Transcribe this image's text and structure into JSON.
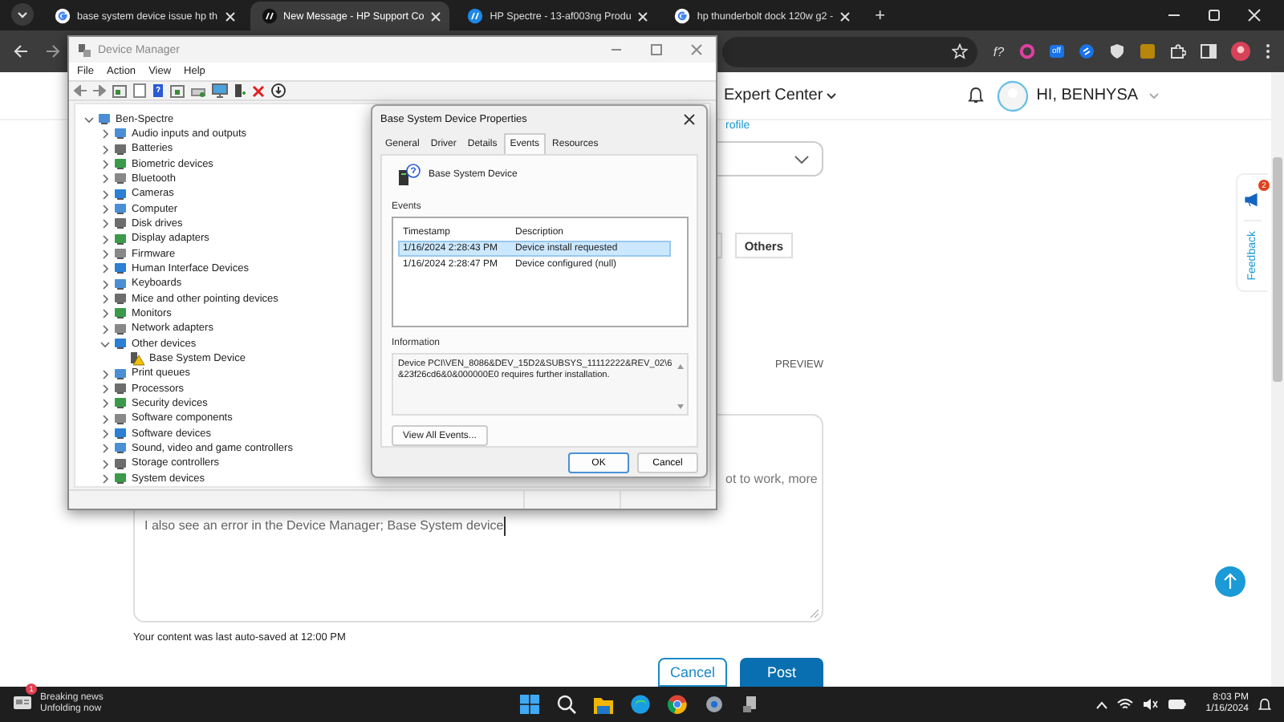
{
  "browser": {
    "tabs": [
      {
        "title": "base system device issue hp th",
        "kind": "search",
        "selected": false
      },
      {
        "title": "New Message - HP Support Co",
        "kind": "support",
        "selected": true
      },
      {
        "title": "HP Spectre - 13-af003ng Produ",
        "kind": "support",
        "selected": false
      },
      {
        "title": "hp thunderbolt dock 120w g2 -",
        "kind": "search",
        "selected": false
      }
    ],
    "new_tab": "+",
    "extension_label": "f?",
    "extension_badge": "off"
  },
  "page": {
    "header": {
      "menu": "Expert Center",
      "user": "HI, BENHYSA"
    },
    "link_fragment": "rofile",
    "chip": "Others",
    "preview": "PREVIEW",
    "message_lines": [
      "ot to work, more",
      "I also see an error in the Device Manager; Base System device"
    ],
    "autosave": "Your content was last auto-saved at 12:00 PM",
    "buttons": {
      "cancel": "Cancel",
      "post": "Post"
    },
    "feedback": {
      "label": "Feedback",
      "badge": "2"
    }
  },
  "device_manager": {
    "title": "Device Manager",
    "menu": [
      "File",
      "Action",
      "View",
      "Help"
    ],
    "tree": [
      {
        "label": "Ben-Spectre",
        "expanded": true,
        "children": [
          {
            "label": "Audio inputs and outputs",
            "expanded": false
          },
          {
            "label": "Batteries",
            "expanded": false
          },
          {
            "label": "Biometric devices",
            "expanded": false
          },
          {
            "label": "Bluetooth",
            "expanded": false
          },
          {
            "label": "Cameras",
            "expanded": false
          },
          {
            "label": "Computer",
            "expanded": false
          },
          {
            "label": "Disk drives",
            "expanded": false
          },
          {
            "label": "Display adapters",
            "expanded": false
          },
          {
            "label": "Firmware",
            "expanded": false
          },
          {
            "label": "Human Interface Devices",
            "expanded": false
          },
          {
            "label": "Keyboards",
            "expanded": false
          },
          {
            "label": "Mice and other pointing devices",
            "expanded": false
          },
          {
            "label": "Monitors",
            "expanded": false
          },
          {
            "label": "Network adapters",
            "expanded": false
          },
          {
            "label": "Other devices",
            "expanded": true,
            "children": [
              {
                "label": "Base System Device",
                "warning": true
              }
            ]
          },
          {
            "label": "Print queues",
            "expanded": false
          },
          {
            "label": "Processors",
            "expanded": false
          },
          {
            "label": "Security devices",
            "expanded": false
          },
          {
            "label": "Software components",
            "expanded": false
          },
          {
            "label": "Software devices",
            "expanded": false
          },
          {
            "label": "Sound, video and game controllers",
            "expanded": false
          },
          {
            "label": "Storage controllers",
            "expanded": false
          },
          {
            "label": "System devices",
            "expanded": false
          }
        ]
      }
    ]
  },
  "properties_dialog": {
    "title": "Base System Device Properties",
    "tabs": [
      {
        "label": "General",
        "selected": false
      },
      {
        "label": "Driver",
        "selected": false
      },
      {
        "label": "Details",
        "selected": false
      },
      {
        "label": "Events",
        "selected": true
      },
      {
        "label": "Resources",
        "selected": false
      }
    ],
    "device_name": "Base System Device",
    "events_label": "Events",
    "columns": [
      "Timestamp",
      "Description"
    ],
    "rows": [
      {
        "timestamp": "1/16/2024 2:28:43 PM",
        "description": "Device install requested",
        "selected": true
      },
      {
        "timestamp": "1/16/2024 2:28:47 PM",
        "description": "Device configured (null)",
        "selected": false
      }
    ],
    "information_label": "Information",
    "information": "Device PCI\\VEN_8086&DEV_15D2&SUBSYS_11112222&REV_02\\6&23f26cd6&0&000000E0 requires further installation.",
    "buttons": {
      "view_all": "View All Events...",
      "ok": "OK",
      "cancel": "Cancel"
    }
  },
  "taskbar": {
    "news": {
      "title": "Breaking news",
      "subtitle": "Unfolding now",
      "badge": "1"
    },
    "time": "8:03 PM",
    "date": "1/16/2024"
  }
}
